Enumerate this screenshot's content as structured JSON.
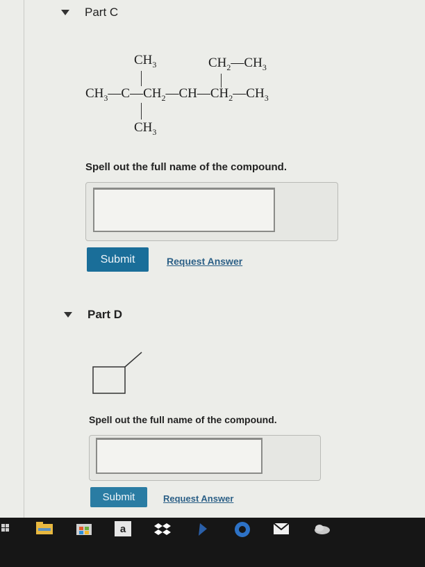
{
  "part_c": {
    "title": "Part C",
    "structure": {
      "top_left_sub": "CH3",
      "top_right_sub": "CH2–CH3",
      "main_chain": "CH3–C–CH2–CH–CH2–CH3",
      "bottom_sub": "CH3"
    },
    "prompt": "Spell out the full name of the compound.",
    "input_value": "",
    "submit_label": "Submit",
    "request_label": "Request Answer"
  },
  "part_d": {
    "title": "Part D",
    "prompt": "Spell out the full name of the compound.",
    "input_value": "",
    "submit_label": "Submit",
    "request_label": "Request Answer"
  },
  "taskbar": {
    "icons": [
      "file-explorer-icon",
      "store-icon",
      "amazon-icon",
      "dropbox-icon",
      "app-icon",
      "edge-icon",
      "mail-icon",
      "weather-icon"
    ],
    "amazon_letter": "a"
  }
}
